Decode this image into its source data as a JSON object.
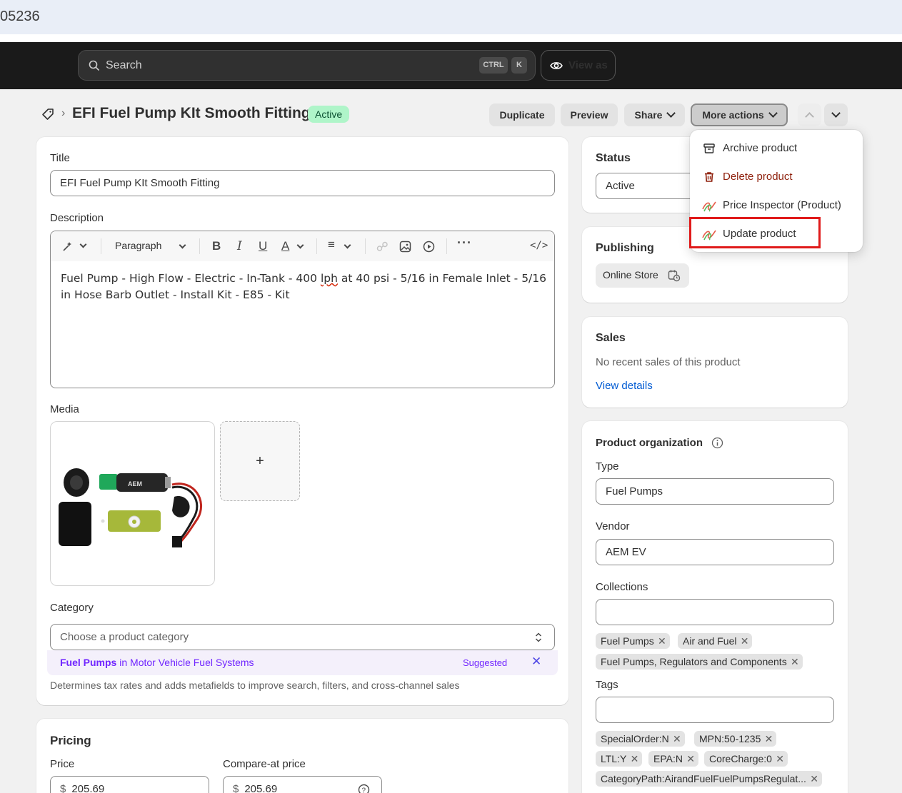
{
  "browser": {
    "url_fragment": "05236"
  },
  "topbar": {
    "search_placeholder": "Search",
    "kbd_ctrl": "CTRL",
    "kbd_k": "K",
    "view_as": "View as"
  },
  "header": {
    "separator": "›",
    "title": "EFI Fuel Pump KIt Smooth Fitting",
    "status_badge": "Active",
    "duplicate": "Duplicate",
    "preview": "Preview",
    "share": "Share",
    "more_actions": "More actions"
  },
  "main": {
    "title_label": "Title",
    "title_value": "EFI Fuel Pump KIt Smooth Fitting",
    "description_label": "Description",
    "toolbar_paragraph": "Paragraph",
    "description_part1": "Fuel Pump - High Flow - Electric - In-Tank - 400 ",
    "description_misspelled": "lph",
    "description_part2": " at 40 psi - 5/16 in Female Inlet - 5/16 in Hose Barb Outlet - Install Kit - E85 - Kit",
    "media_label": "Media",
    "media_add": "+",
    "category_label": "Category",
    "category_placeholder": "Choose a product category",
    "suggestion_bold": "Fuel Pumps",
    "suggestion_rest": " in Motor Vehicle Fuel Systems",
    "suggested_label": "Suggested",
    "dismiss": "✕",
    "category_help": "Determines tax rates and adds metafields to improve search, filters, and cross-channel sales",
    "pricing_title": "Pricing",
    "price_label": "Price",
    "price_currency": "$",
    "price_value": "205.69",
    "compare_label": "Compare-at price",
    "compare_currency": "$",
    "compare_value": "205.69"
  },
  "sidebar": {
    "status_title": "Status",
    "status_value": "Active",
    "publishing_title": "Publishing",
    "online_store": "Online Store",
    "sales_title": "Sales",
    "sales_text": "No recent sales of this product",
    "view_details": "View details",
    "org_title": "Product organization",
    "type_label": "Type",
    "type_value": "Fuel Pumps",
    "vendor_label": "Vendor",
    "vendor_value": "AEM EV",
    "collections_label": "Collections",
    "collections": [
      "Fuel Pumps",
      "Air and Fuel",
      "Fuel Pumps, Regulators and Components"
    ],
    "tags_label": "Tags",
    "tags": [
      "SpecialOrder:N",
      "MPN:50-1235",
      "LTL:Y",
      "EPA:N",
      "CoreCharge:0",
      "CategoryPath:AirandFuelFuelPumpsRegulat..."
    ],
    "remove": "✕"
  },
  "menu": {
    "items": [
      {
        "label": "Archive product",
        "icon": "archive-icon"
      },
      {
        "label": "Delete product",
        "icon": "trash-icon"
      },
      {
        "label": "Price Inspector (Product)",
        "icon": "app-icon"
      },
      {
        "label": "Update product",
        "icon": "app-icon"
      }
    ]
  },
  "colors": {
    "accent_link": "#005bd3",
    "danger": "#8e1f0b",
    "badge_bg": "#aff5c9",
    "highlight": "#e01a1a",
    "suggest": "#7126ff"
  }
}
